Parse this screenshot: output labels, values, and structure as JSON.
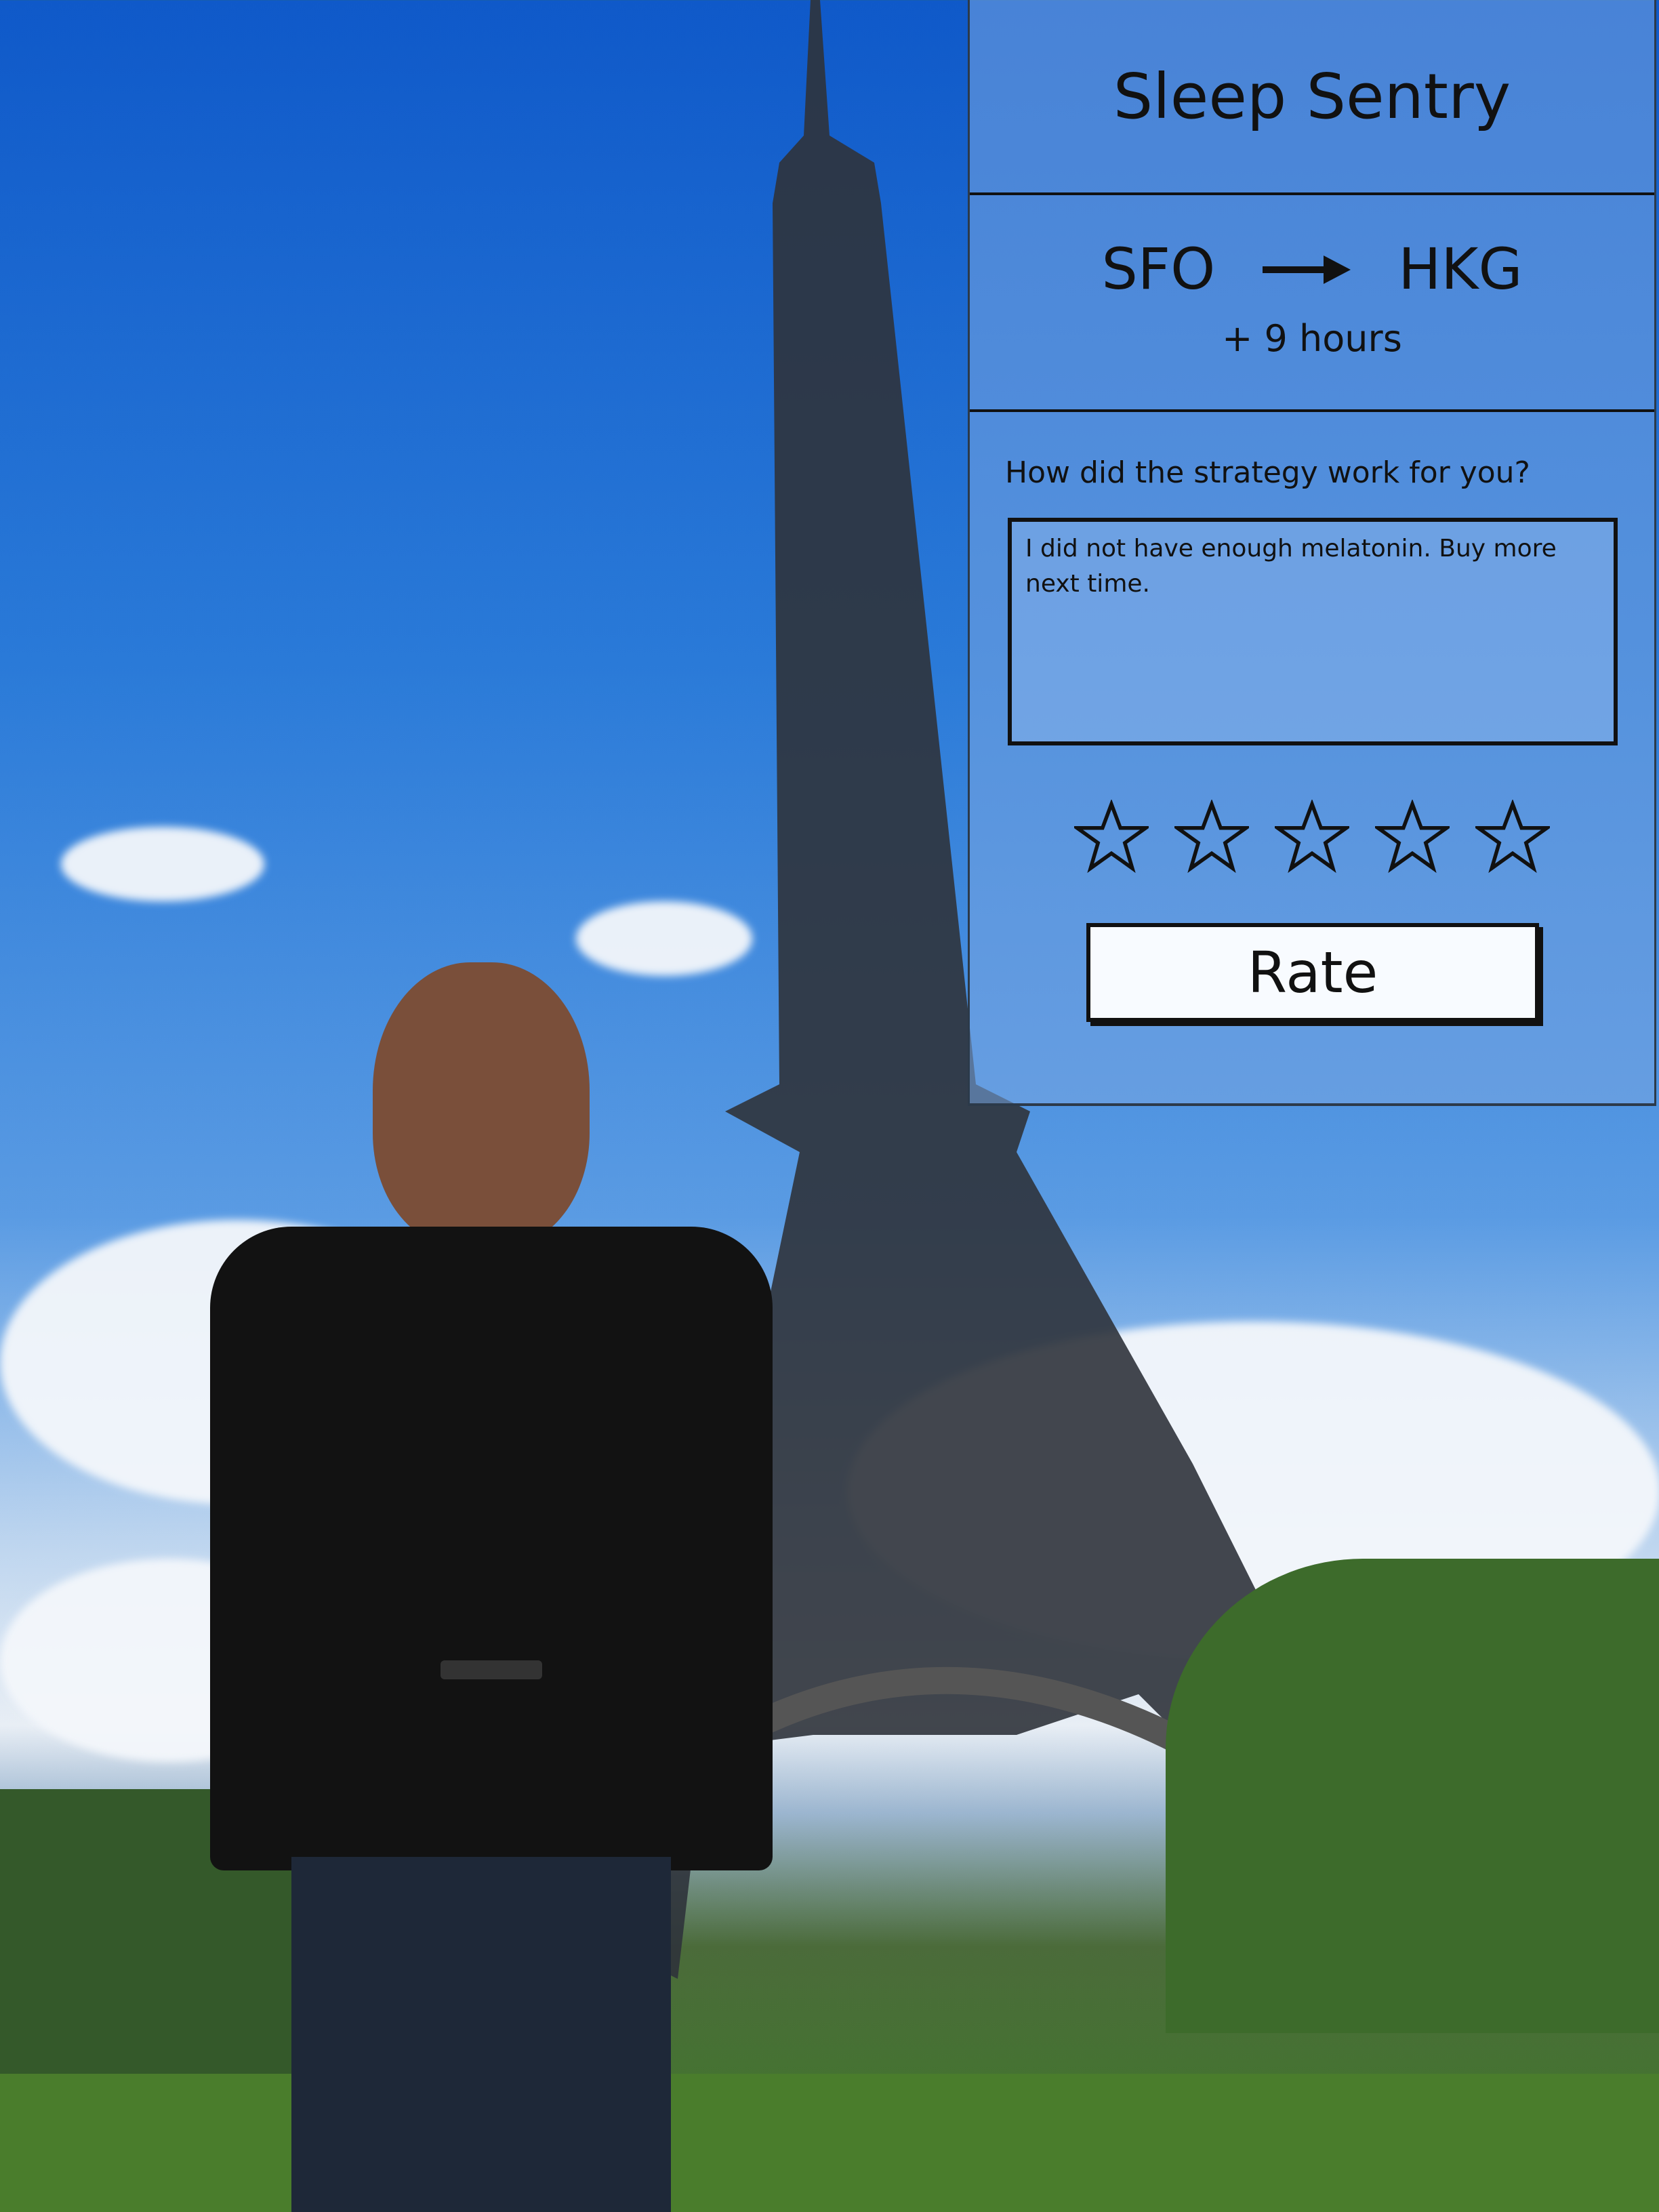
{
  "app": {
    "title": "Sleep Sentry"
  },
  "route": {
    "origin": "SFO",
    "destination": "HKG",
    "time_offset": "+ 9 hours"
  },
  "feedback": {
    "question": "How did the strategy work for you?",
    "text": "I did not have enough melatonin. Buy more next time."
  },
  "rating": {
    "max_stars": 5,
    "selected_stars": 0
  },
  "actions": {
    "rate_label": "Rate"
  },
  "background": {
    "description_icon": "eiffel-tower-photo"
  }
}
